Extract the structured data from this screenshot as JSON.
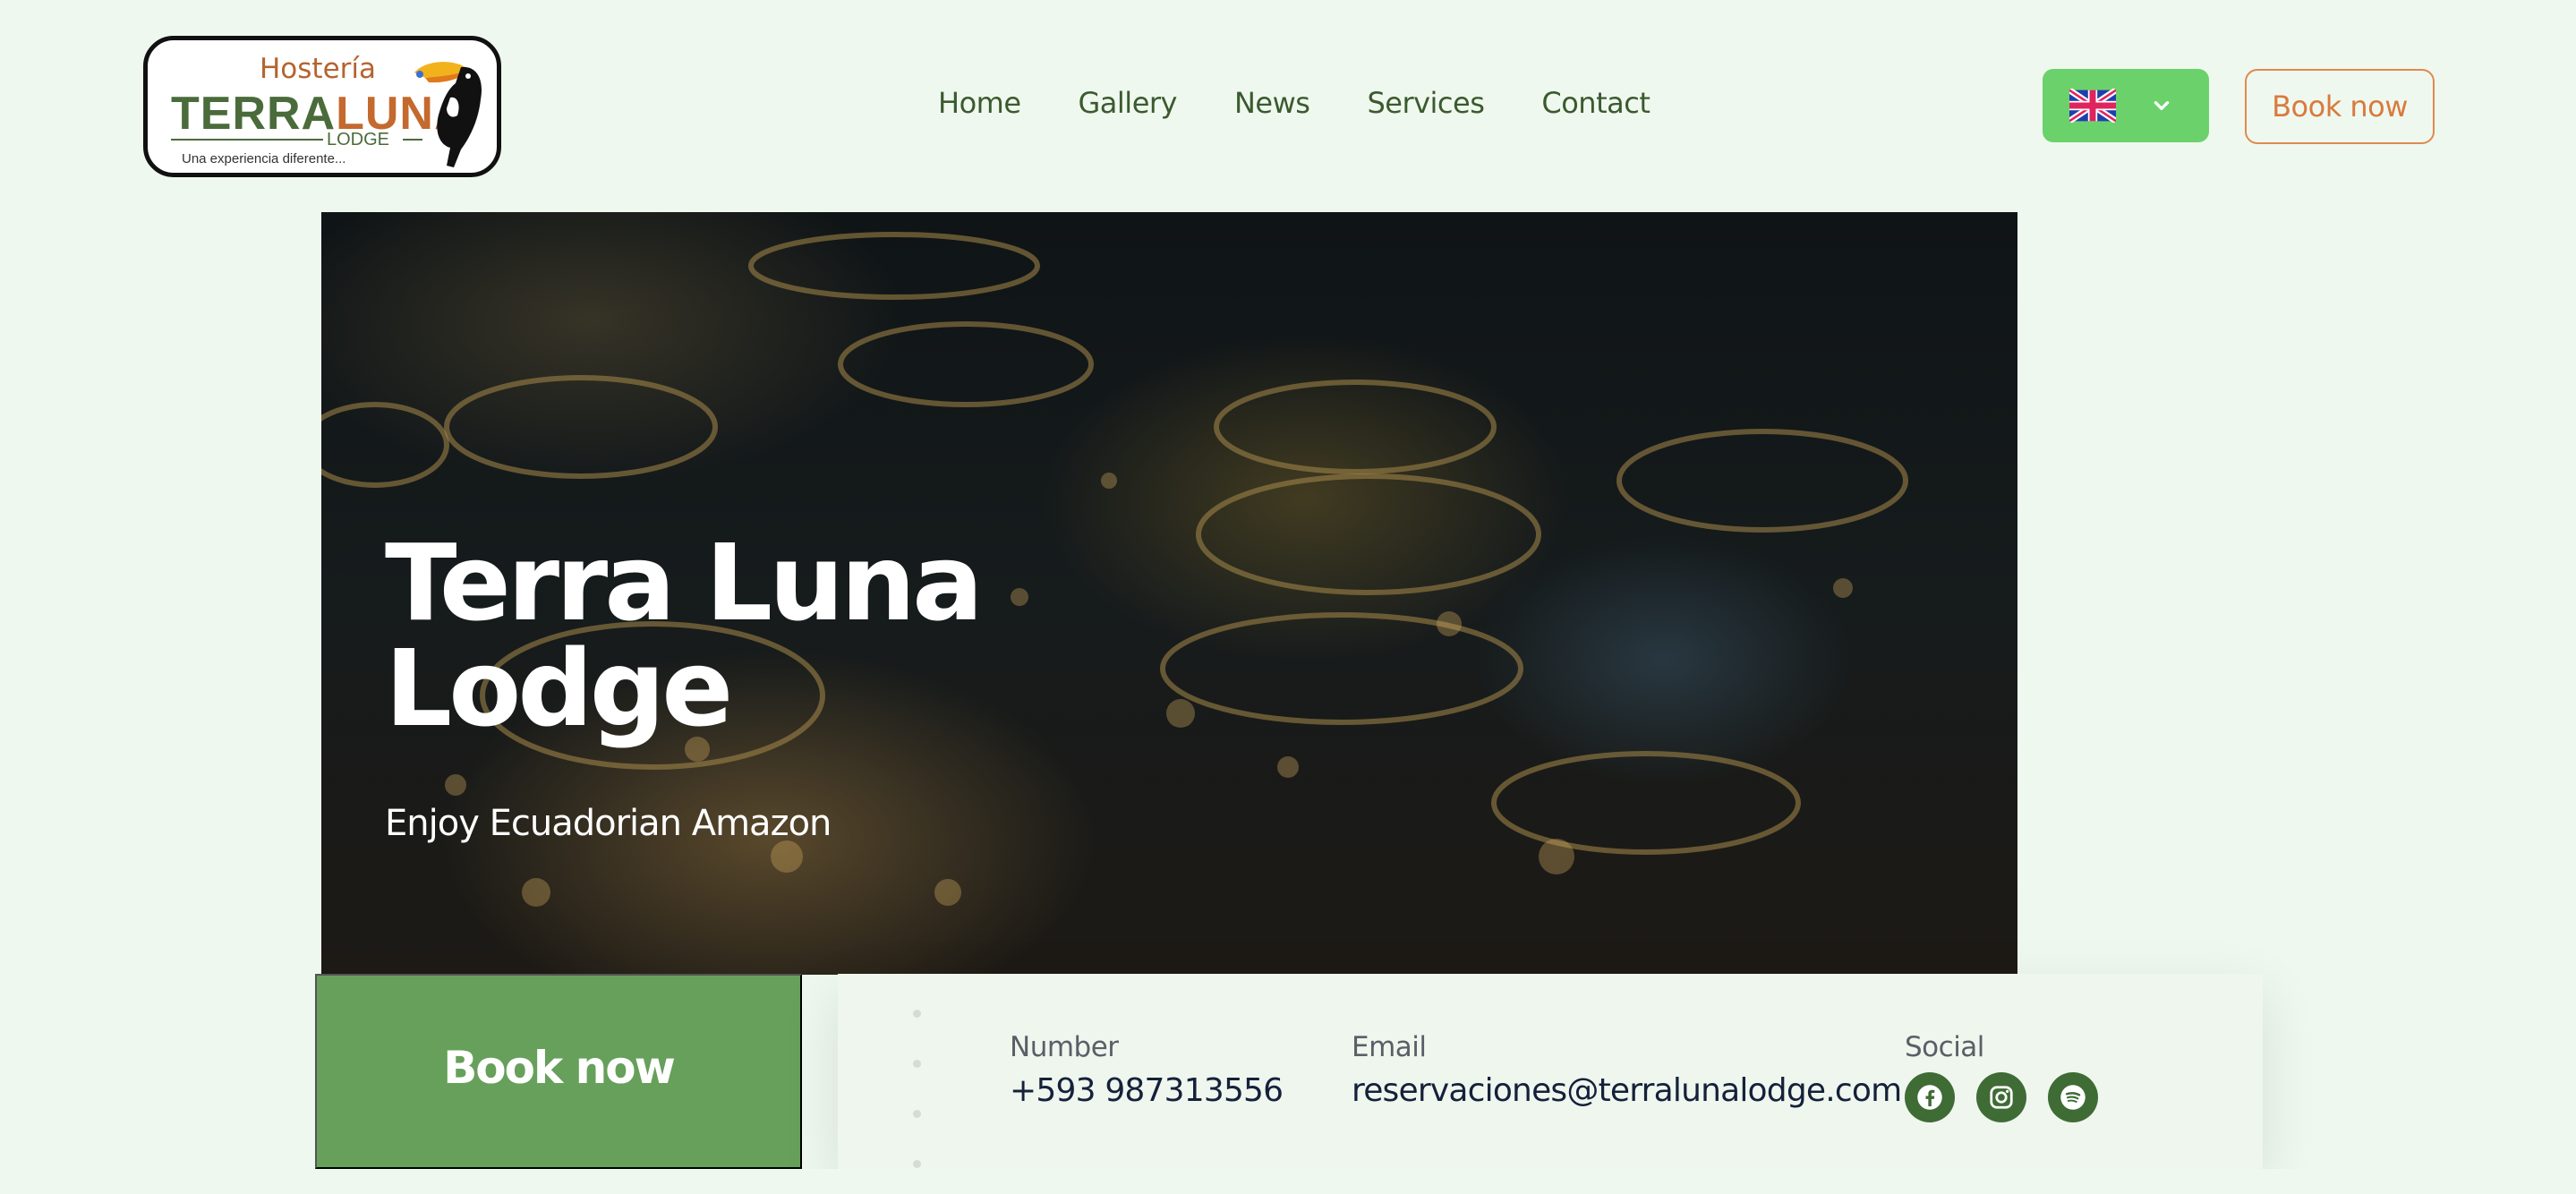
{
  "logo": {
    "top_text": "Hostería",
    "name_part1": "TERRA",
    "name_part2": "LUNA",
    "sub_text": "LODGE",
    "tagline": "Una experiencia diferente...",
    "icon": "toucan-icon"
  },
  "nav": {
    "items": [
      {
        "label": "Home"
      },
      {
        "label": "Gallery"
      },
      {
        "label": "News"
      },
      {
        "label": "Services"
      },
      {
        "label": "Contact"
      }
    ]
  },
  "language": {
    "flag_icon": "uk-flag-icon",
    "chevron_icon": "chevron-down-icon"
  },
  "header": {
    "book_label": "Book now"
  },
  "hero": {
    "title": "Terra Luna Lodge",
    "subtitle": "Enjoy Ecuadorian Amazon"
  },
  "info": {
    "book_label": "Book now",
    "number_label": "Number",
    "number_value": "+593 987313556",
    "email_label": "Email",
    "email_value": "reservaciones@terralunalodge.com",
    "social_label": "Social",
    "social_icons": [
      "facebook-icon",
      "instagram-icon",
      "spotify-icon"
    ]
  },
  "colors": {
    "page_bg": "#eff8ef",
    "primary_green": "#66a05a",
    "lang_green": "#6bd26b",
    "accent_orange": "#d97a3d",
    "nav_text": "#3b5a2e",
    "social_bg": "#3f6b35"
  }
}
